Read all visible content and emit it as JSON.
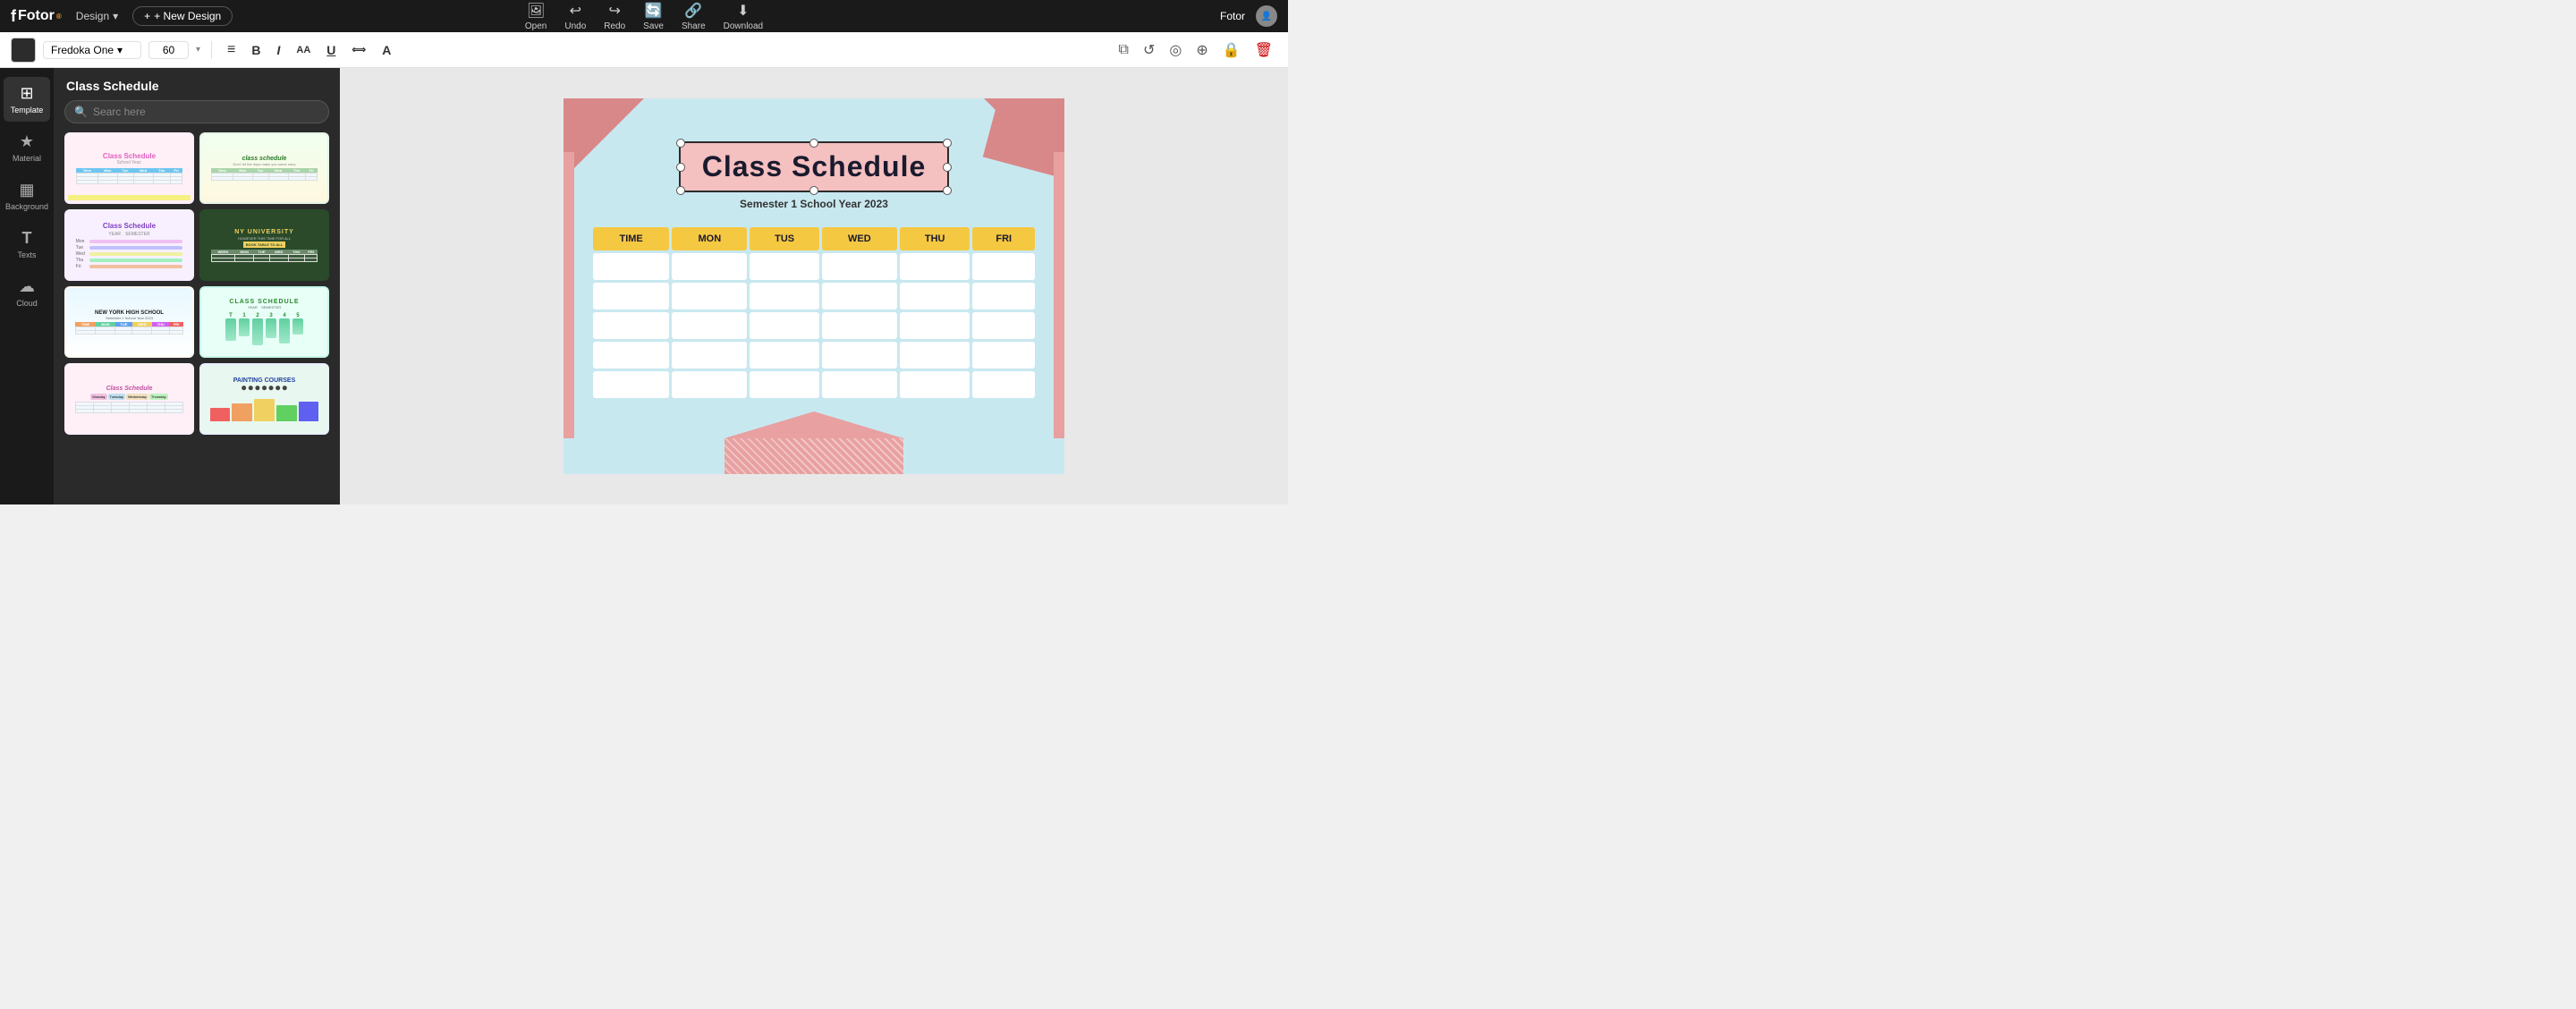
{
  "app": {
    "logo": "Fotor",
    "design_label": "Design",
    "new_design_label": "+ New Design",
    "username": "Fotor"
  },
  "toolbar_top": {
    "open_label": "Open",
    "undo_label": "Undo",
    "redo_label": "Redo",
    "save_label": "Save",
    "share_label": "Share",
    "download_label": "Download"
  },
  "text_toolbar": {
    "font_color": "#2c2c2c",
    "font_name": "Fredoka One",
    "font_size": "60",
    "align_icon": "≡",
    "bold_icon": "B",
    "italic_icon": "I",
    "font_size_icon": "AA",
    "underline_icon": "U",
    "letter_spacing_icon": "⟺",
    "text_case_icon": "A"
  },
  "sidebar": {
    "items": [
      {
        "id": "template",
        "label": "Template",
        "icon": "⊞"
      },
      {
        "id": "material",
        "label": "Material",
        "icon": "★"
      },
      {
        "id": "background",
        "label": "Background",
        "icon": "▦"
      },
      {
        "id": "texts",
        "label": "Texts",
        "icon": "T"
      },
      {
        "id": "cloud",
        "label": "Cloud",
        "icon": "☁"
      }
    ],
    "active": "template"
  },
  "panel": {
    "title": "Class Schedule",
    "search_placeholder": "Searc here",
    "templates": [
      {
        "id": "t1",
        "bg": "#fff0f8",
        "title": "Class Schedule",
        "color": "#e060c0"
      },
      {
        "id": "t2",
        "bg": "#e8f8e8",
        "title": "class schedule",
        "color": "#2a7a2a"
      },
      {
        "id": "t3",
        "bg": "#f0e8ff",
        "title": "Class Schedule",
        "color": "#8040c0"
      },
      {
        "id": "t4",
        "bg": "#2a4a2a",
        "title": "NY UNIVERSITY",
        "color": "#ffffff"
      },
      {
        "id": "t5",
        "bg": "#fff8f0",
        "title": "NEW YORK HIGH SCHOOL",
        "color": "#1a1a1a"
      },
      {
        "id": "t6",
        "bg": "#c8f8e8",
        "title": "CLASS SCHEDULE",
        "color": "#2a8a2a"
      },
      {
        "id": "t7",
        "bg": "#ffe8f8",
        "title": "Class Schedule",
        "color": "#c050a0"
      },
      {
        "id": "t8",
        "bg": "#e8f0ff",
        "title": "PAINTING COURSES",
        "color": "#2040a0"
      }
    ]
  },
  "canvas": {
    "title": "Class Schedule",
    "subtitle": "Semester 1 School Year 2023",
    "table_headers": [
      "TIME",
      "MON",
      "TUS",
      "WED",
      "THU",
      "FRI"
    ],
    "rows": 5
  }
}
